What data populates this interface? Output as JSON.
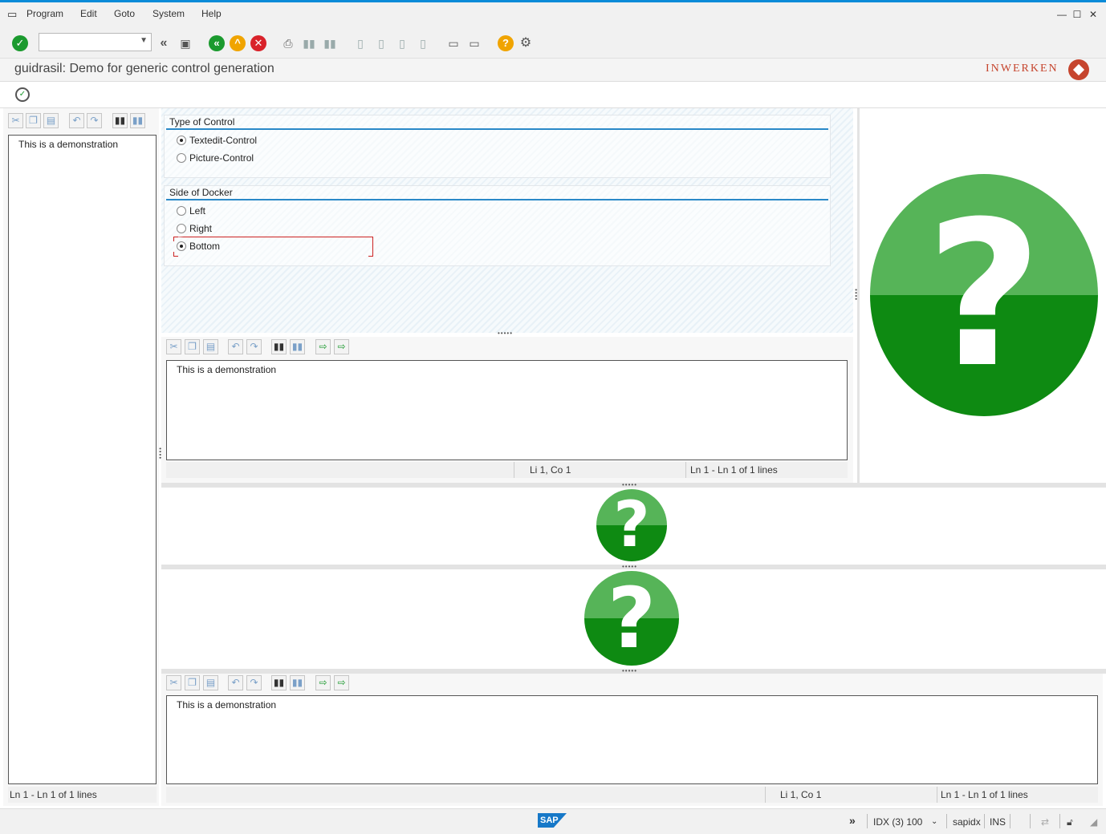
{
  "menu": {
    "items": [
      "Program",
      "Edit",
      "Goto",
      "System",
      "Help"
    ]
  },
  "window": {
    "minimize": "—",
    "maximize": "☐",
    "close": "✕"
  },
  "toolbar": {
    "command_value": "",
    "enter_icon": "check-icon",
    "back_icon": "back-icon",
    "exit_icon": "exit-icon",
    "cancel_icon": "cancel-icon",
    "help_icon": "help-icon",
    "settings_icon": "gear-icon"
  },
  "title": {
    "text": "guidrasil: Demo for generic control generation",
    "brand": "INWERKEN"
  },
  "left_editor": {
    "text": "This is a demonstration",
    "status": "Ln 1 - Ln 1 of 1 lines"
  },
  "control_type": {
    "title": "Type of Control",
    "options": [
      {
        "label": "Textedit-Control",
        "selected": true
      },
      {
        "label": "Picture-Control",
        "selected": false
      }
    ]
  },
  "docker_side": {
    "title": "Side of Docker",
    "options": [
      {
        "label": "Left",
        "selected": false
      },
      {
        "label": "Right",
        "selected": false
      },
      {
        "label": "Bottom",
        "selected": true
      }
    ]
  },
  "mid_editor": {
    "text": "This is a demonstration",
    "cursor": "Li 1, Co 1",
    "lines": "Ln 1 - Ln 1 of 1 lines"
  },
  "bottom_editor": {
    "text": "This is a demonstration",
    "cursor": "Li 1, Co 1",
    "lines": "Ln 1 - Ln 1 of 1 lines"
  },
  "pictures": {
    "glyph": "?",
    "icon": "question-mark-icon"
  },
  "status": {
    "logo": "SAP",
    "system": "IDX (3) 100",
    "server": "sapidx",
    "mode": "INS"
  },
  "colors": {
    "accent": "#0a8bd8",
    "brand": "#c6452e",
    "green_top": "#56b458",
    "green_bottom": "#0e8a12"
  }
}
